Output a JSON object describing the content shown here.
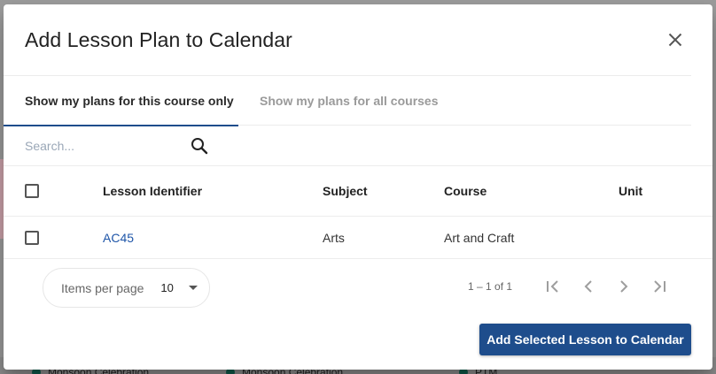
{
  "dialog": {
    "title": "Add Lesson Plan to Calendar"
  },
  "tabs": [
    {
      "label": "Show my plans for this course only",
      "active": true
    },
    {
      "label": "Show my plans for all courses",
      "active": false
    }
  ],
  "search": {
    "placeholder": "Search...",
    "value": ""
  },
  "table": {
    "columns": [
      "Lesson Identifier",
      "Subject",
      "Course",
      "Unit"
    ],
    "rows": [
      {
        "lesson_identifier": "AC45",
        "subject": "Arts",
        "course": "Art and Craft",
        "unit": ""
      }
    ]
  },
  "paginator": {
    "items_per_page_label": "Items per page",
    "items_per_page_value": "10",
    "range_label": "1 – 1 of 1"
  },
  "actions": {
    "add_selected_label": "Add Selected Lesson to Calendar"
  },
  "background": {
    "events": [
      "Monsoon Celebration",
      "Monsoon Celebration",
      "PTM"
    ]
  },
  "colors": {
    "primary": "#1e4d8c",
    "link": "#1e55a8",
    "event_dot": "#0e5c4c"
  }
}
